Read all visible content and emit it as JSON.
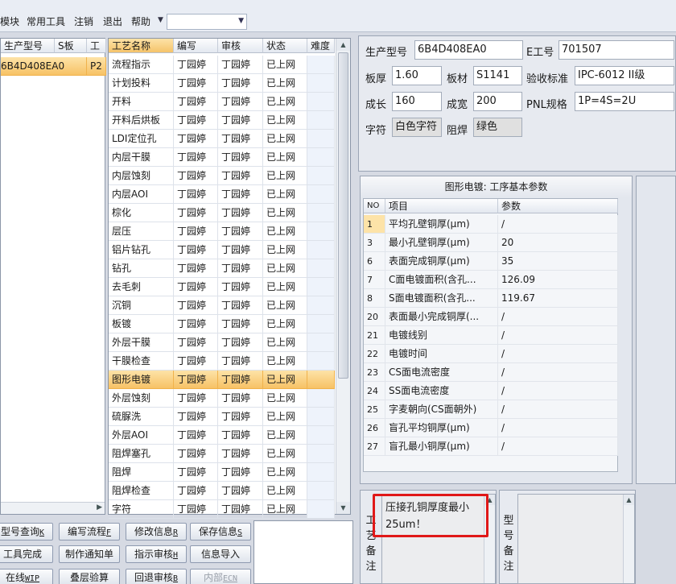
{
  "menubar": {
    "items": [
      "模块",
      "常用工具",
      "注销",
      "退出",
      "帮助"
    ],
    "combo_value": ""
  },
  "model_grid": {
    "columns": [
      "生产型号",
      "S板",
      "工"
    ],
    "rows": [
      {
        "model": "6B4D408EA0",
        "s": "",
        "t": "P2"
      }
    ]
  },
  "process_grid": {
    "columns": [
      "工艺名称",
      "编写",
      "审核",
      "状态",
      "难度"
    ],
    "selected_index": 17,
    "rows": [
      {
        "name": "流程指示",
        "writer": "丁园婷",
        "reviewer": "丁园婷",
        "status": "已上网"
      },
      {
        "name": "计划投料",
        "writer": "丁园婷",
        "reviewer": "丁园婷",
        "status": "已上网"
      },
      {
        "name": "开料",
        "writer": "丁园婷",
        "reviewer": "丁园婷",
        "status": "已上网"
      },
      {
        "name": "开料后烘板",
        "writer": "丁园婷",
        "reviewer": "丁园婷",
        "status": "已上网"
      },
      {
        "name": "LDI定位孔",
        "writer": "丁园婷",
        "reviewer": "丁园婷",
        "status": "已上网"
      },
      {
        "name": "内层干膜",
        "writer": "丁园婷",
        "reviewer": "丁园婷",
        "status": "已上网"
      },
      {
        "name": "内层蚀刻",
        "writer": "丁园婷",
        "reviewer": "丁园婷",
        "status": "已上网"
      },
      {
        "name": "内层AOI",
        "writer": "丁园婷",
        "reviewer": "丁园婷",
        "status": "已上网"
      },
      {
        "name": "棕化",
        "writer": "丁园婷",
        "reviewer": "丁园婷",
        "status": "已上网"
      },
      {
        "name": "层压",
        "writer": "丁园婷",
        "reviewer": "丁园婷",
        "status": "已上网"
      },
      {
        "name": "铝片钻孔",
        "writer": "丁园婷",
        "reviewer": "丁园婷",
        "status": "已上网"
      },
      {
        "name": "钻孔",
        "writer": "丁园婷",
        "reviewer": "丁园婷",
        "status": "已上网"
      },
      {
        "name": "去毛刺",
        "writer": "丁园婷",
        "reviewer": "丁园婷",
        "status": "已上网"
      },
      {
        "name": "沉铜",
        "writer": "丁园婷",
        "reviewer": "丁园婷",
        "status": "已上网"
      },
      {
        "name": "板镀",
        "writer": "丁园婷",
        "reviewer": "丁园婷",
        "status": "已上网"
      },
      {
        "name": "外层干膜",
        "writer": "丁园婷",
        "reviewer": "丁园婷",
        "status": "已上网"
      },
      {
        "name": "干膜检查",
        "writer": "丁园婷",
        "reviewer": "丁园婷",
        "status": "已上网"
      },
      {
        "name": "图形电镀",
        "writer": "丁园婷",
        "reviewer": "丁园婷",
        "status": "已上网"
      },
      {
        "name": "外层蚀刻",
        "writer": "丁园婷",
        "reviewer": "丁园婷",
        "status": "已上网"
      },
      {
        "name": "硫脲洗",
        "writer": "丁园婷",
        "reviewer": "丁园婷",
        "status": "已上网"
      },
      {
        "name": "外层AOI",
        "writer": "丁园婷",
        "reviewer": "丁园婷",
        "status": "已上网"
      },
      {
        "name": "阻焊塞孔",
        "writer": "丁园婷",
        "reviewer": "丁园婷",
        "status": "已上网"
      },
      {
        "name": "阻焊",
        "writer": "丁园婷",
        "reviewer": "丁园婷",
        "status": "已上网"
      },
      {
        "name": "阻焊检查",
        "writer": "丁园婷",
        "reviewer": "丁园婷",
        "status": "已上网"
      },
      {
        "name": "字符",
        "writer": "丁园婷",
        "reviewer": "丁园婷",
        "status": "已上网"
      }
    ]
  },
  "buttons": [
    {
      "label": "型号查询",
      "key": "K",
      "disabled": false
    },
    {
      "label": "编写流程",
      "key": "F",
      "disabled": false
    },
    {
      "label": "修改信息",
      "key": "R",
      "disabled": false
    },
    {
      "label": "保存信息",
      "key": "S",
      "disabled": false
    },
    {
      "label": "工具完成",
      "key": "",
      "disabled": false
    },
    {
      "label": "制作通知单",
      "key": "",
      "disabled": false
    },
    {
      "label": "指示审核",
      "key": "H",
      "disabled": false
    },
    {
      "label": "信息导入",
      "key": "",
      "disabled": false
    },
    {
      "label": "在线",
      "key": "WIP",
      "disabled": false
    },
    {
      "label": "叠层验算",
      "key": "",
      "disabled": false
    },
    {
      "label": "回退审核",
      "key": "B",
      "disabled": false
    },
    {
      "label": "内部",
      "key": "ECN",
      "disabled": true
    }
  ],
  "info": {
    "model_label": "生产型号",
    "model_value": "6B4D408EA0",
    "e_label": "E工号",
    "e_value": "701507",
    "thickness_label": "板厚",
    "thickness_value": "1.60",
    "material_label": "板材",
    "material_value": "S1141",
    "standard_label": "验收标准",
    "standard_value": "IPC-6012 II级",
    "length_label": "成长",
    "length_value": "160",
    "width_label": "成宽",
    "width_value": "200",
    "pnl_label": "PNL规格",
    "pnl_value": "1P=4S=2U",
    "char_label": "字符",
    "char_value": "白色字符",
    "mask_label": "阻焊",
    "mask_value": "绿色"
  },
  "params": {
    "title": "图形电镀: 工序基本参数",
    "columns": [
      "NO",
      "项目",
      "参数"
    ],
    "rows": [
      {
        "no": "1",
        "item": "平均孔壁铜厚(μm)",
        "value": "/"
      },
      {
        "no": "3",
        "item": "最小孔壁铜厚(μm)",
        "value": "20"
      },
      {
        "no": "6",
        "item": "表面完成铜厚(μm)",
        "value": "35"
      },
      {
        "no": "7",
        "item": "C面电镀面积(含孔...",
        "value": "126.09"
      },
      {
        "no": "8",
        "item": "S面电镀面积(含孔...",
        "value": "119.67"
      },
      {
        "no": "20",
        "item": "表面最小完成铜厚(...",
        "value": "/"
      },
      {
        "no": "21",
        "item": "电镀线别",
        "value": "/"
      },
      {
        "no": "22",
        "item": "电镀时间",
        "value": "/"
      },
      {
        "no": "23",
        "item": "CS面电流密度",
        "value": "/"
      },
      {
        "no": "24",
        "item": "SS面电流密度",
        "value": "/"
      },
      {
        "no": "25",
        "item": "字麦朝向(CS面朝外)",
        "value": "/"
      },
      {
        "no": "26",
        "item": "盲孔平均铜厚(μm)",
        "value": "/"
      },
      {
        "no": "27",
        "item": "盲孔最小铜厚(μm)",
        "value": "/"
      }
    ]
  },
  "notes": {
    "process_label": "工艺备注",
    "process_text": "压接孔铜厚度最小25um！",
    "model_label": "型号备注",
    "model_text": ""
  },
  "colors": {
    "selection": "#f7c265",
    "highlight_box": "#e01818"
  }
}
